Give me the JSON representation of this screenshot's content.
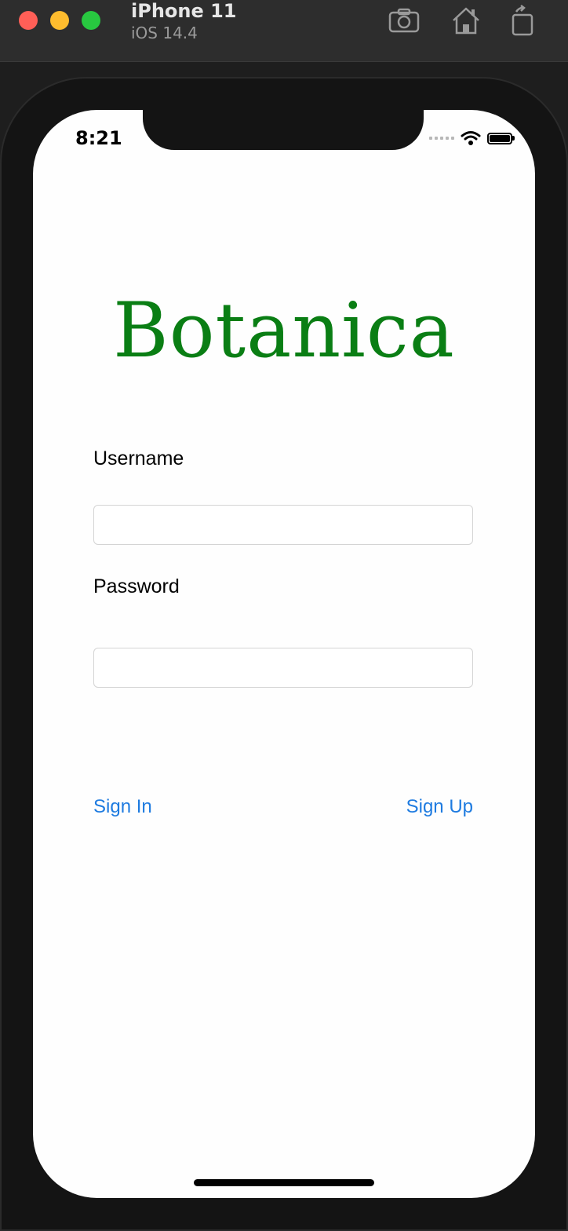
{
  "simulator": {
    "device_name": "iPhone 11",
    "os_version": "iOS 14.4",
    "toolbar_icons": [
      "screenshot-icon",
      "home-icon",
      "rotate-icon"
    ],
    "window_controls": [
      "close",
      "minimize",
      "zoom"
    ]
  },
  "status_bar": {
    "time": "8:21",
    "icons": [
      "cellular-signal-icon",
      "wifi-icon",
      "battery-icon"
    ]
  },
  "app": {
    "title": "Botanica",
    "title_color": "#0a7e14",
    "username": {
      "label": "Username",
      "value": "",
      "placeholder": ""
    },
    "password": {
      "label": "Password",
      "value": "",
      "placeholder": ""
    },
    "sign_in_label": "Sign In",
    "sign_up_label": "Sign Up",
    "link_color": "#1e7be0"
  }
}
